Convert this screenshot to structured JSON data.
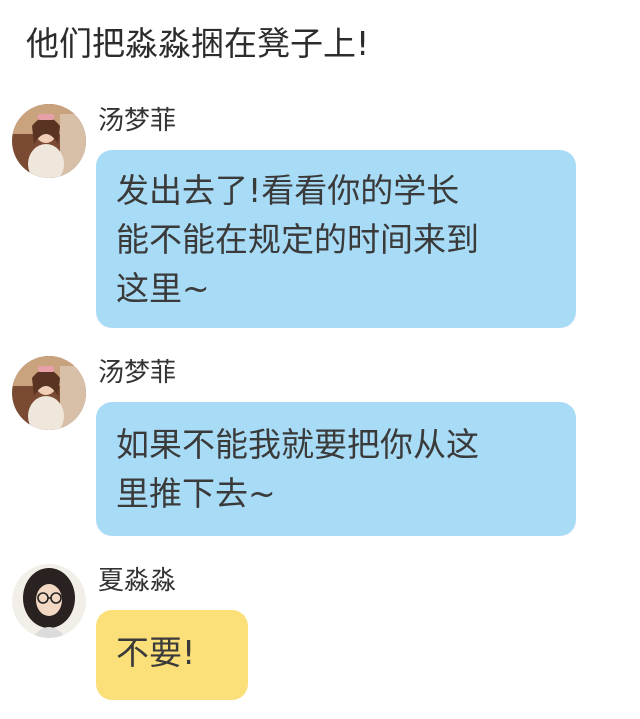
{
  "narration": "他们把淼淼捆在凳子上!",
  "messages": [
    {
      "sender": "汤梦菲",
      "avatar_icon": "girl-portrait-avatar-icon",
      "bubble_color": "#a8dcf6",
      "lines": [
        "发出去了!看看你的学长",
        "能不能在规定的时间来到",
        "这里~"
      ]
    },
    {
      "sender": "汤梦菲",
      "avatar_icon": "girl-portrait-avatar-icon",
      "bubble_color": "#a8dcf6",
      "lines": [
        "如果不能我就要把你从这",
        "里推下去~"
      ]
    },
    {
      "sender": "夏淼淼",
      "avatar_icon": "girl-glasses-avatar-icon",
      "bubble_color": "#fbe07a",
      "lines": [
        "不要!"
      ]
    }
  ]
}
